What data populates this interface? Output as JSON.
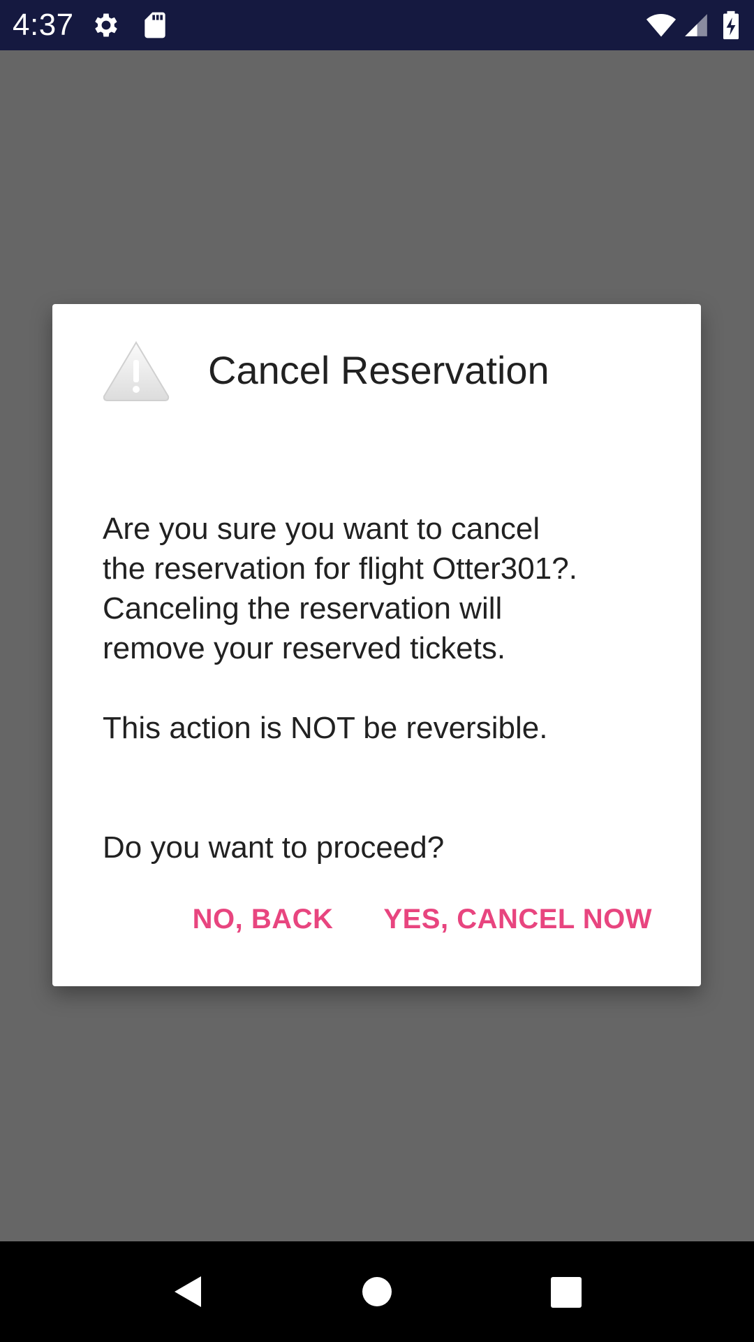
{
  "status_bar": {
    "time": "4:37",
    "icons": [
      "settings-icon",
      "sd-card-icon",
      "wifi-icon",
      "signal-icon",
      "battery-charging-icon"
    ]
  },
  "dialog": {
    "icon": "warning-icon",
    "title": "Cancel Reservation",
    "message": {
      "line1": "Are you sure you want to cancel",
      "line2": "the reservation for flight Otter301?.",
      "line3": "Canceling the reservation will",
      "line4": "remove your reserved tickets.",
      "line5": "This action is NOT be reversible.",
      "line6": "Do you want to proceed?"
    },
    "buttons": {
      "negative": "NO, BACK",
      "positive": "YES, CANCEL NOW"
    }
  },
  "nav_bar": {
    "icons": [
      "back-icon",
      "home-icon",
      "recents-icon"
    ]
  },
  "colors": {
    "status_bar": "#151940",
    "scrim": "#666666",
    "dialog_background": "#ffffff",
    "accent": "#e8457f",
    "text": "#212121"
  }
}
